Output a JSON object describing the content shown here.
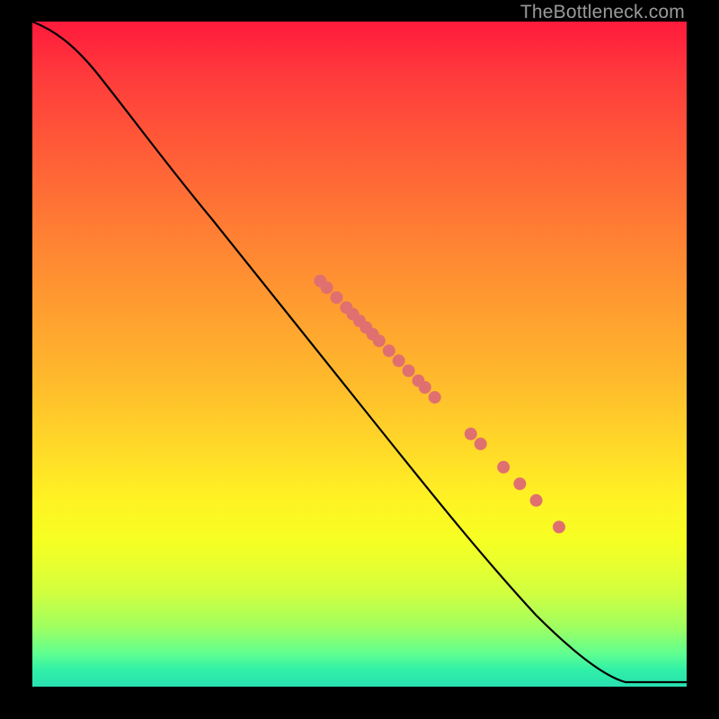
{
  "watermark": "TheBottleneck.com",
  "colors": {
    "dot": "#e07070",
    "line": "#000000",
    "frame": "#000000"
  },
  "chart_data": {
    "type": "line",
    "title": "",
    "xlabel": "",
    "ylabel": "",
    "xlim": [
      0,
      100
    ],
    "ylim": [
      0,
      100
    ],
    "grid": false,
    "legend": false,
    "series": [
      {
        "name": "curve",
        "x": [
          0,
          4,
          8,
          12,
          18,
          26,
          34,
          42,
          50,
          58,
          66,
          74,
          82,
          88,
          91,
          100
        ],
        "y": [
          100,
          98,
          95,
          92,
          87,
          79,
          71,
          63,
          55,
          47,
          39,
          31,
          23,
          14,
          5,
          5
        ]
      }
    ],
    "points": [
      {
        "x": 44,
        "y": 61.0
      },
      {
        "x": 45,
        "y": 60.0
      },
      {
        "x": 46.5,
        "y": 58.5
      },
      {
        "x": 48,
        "y": 57.0
      },
      {
        "x": 49,
        "y": 56.0
      },
      {
        "x": 50,
        "y": 55.0
      },
      {
        "x": 51,
        "y": 54.0
      },
      {
        "x": 52,
        "y": 53.0
      },
      {
        "x": 53,
        "y": 52.0
      },
      {
        "x": 54.5,
        "y": 50.5
      },
      {
        "x": 56,
        "y": 49.0
      },
      {
        "x": 57.5,
        "y": 47.5
      },
      {
        "x": 59,
        "y": 46.0
      },
      {
        "x": 60,
        "y": 45.0
      },
      {
        "x": 61.5,
        "y": 43.5
      },
      {
        "x": 67,
        "y": 38.0
      },
      {
        "x": 68.5,
        "y": 36.5
      },
      {
        "x": 72,
        "y": 33.0
      },
      {
        "x": 74.5,
        "y": 30.5
      },
      {
        "x": 77,
        "y": 28.0
      },
      {
        "x": 80.5,
        "y": 24.0
      }
    ],
    "point_radius_px": 7
  }
}
